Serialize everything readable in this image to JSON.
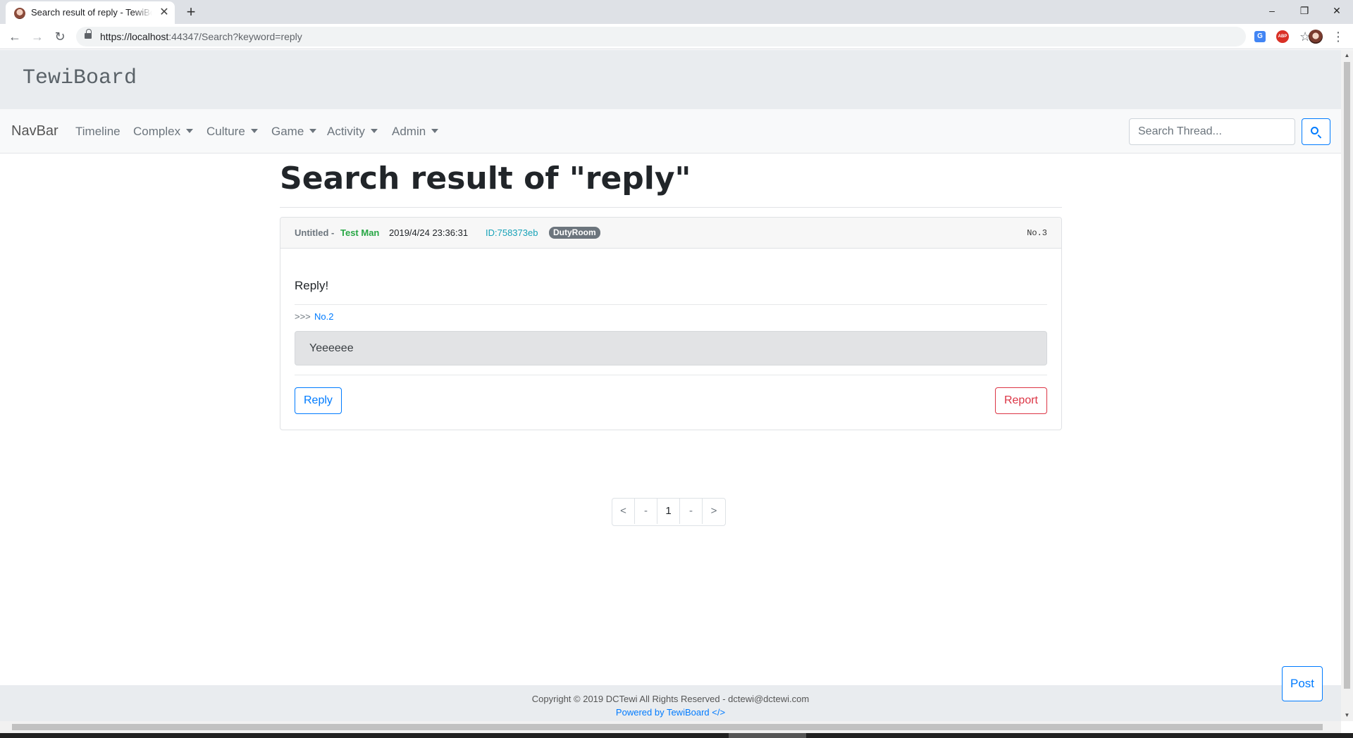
{
  "browser": {
    "tab_title": "Search result of reply - TewiBoard",
    "tab_close": "✕",
    "new_tab": "+",
    "url_host": "https://localhost",
    "url_rest": ":44347/Search?keyword=reply",
    "window_controls": {
      "minimize": "–",
      "maximize": "❐",
      "close": "✕"
    },
    "nav": {
      "back": "←",
      "forward": "→",
      "reload": "↻"
    },
    "bookmark_star": "☆",
    "menu": "⋮",
    "ext_translate": "G",
    "ext_abp": "ABP"
  },
  "site": {
    "brand": "TewiBoard"
  },
  "navbar": {
    "brand": "NavBar",
    "links": [
      {
        "label": "Timeline"
      },
      {
        "label": "Complex"
      },
      {
        "label": "Culture"
      },
      {
        "label": "Game"
      },
      {
        "label": "Activity"
      },
      {
        "label": "Admin"
      }
    ],
    "search_placeholder": "Search Thread..."
  },
  "main": {
    "title": "Search result of \"reply\"",
    "post": {
      "title": "Untitled -",
      "author": "Test Man",
      "timestamp": "2019/4/24 23:36:31",
      "user_id": "ID:758373eb",
      "board_badge": "DutyRoom",
      "number": "No.3",
      "body": "Reply!",
      "quote_prefix": ">>>",
      "quote_link": "No.2",
      "quote_text": "Yeeeeee",
      "reply_label": "Reply",
      "report_label": "Report"
    },
    "pagination": [
      "<",
      "-",
      "1",
      "-",
      ">"
    ],
    "pagination_active": "1"
  },
  "footer": {
    "copyright": "Copyright © 2019 DCTewi All Rights Reserved - dctewi@dctewi.com",
    "powered": "Powered by TewiBoard </>"
  },
  "post_button": "Post"
}
